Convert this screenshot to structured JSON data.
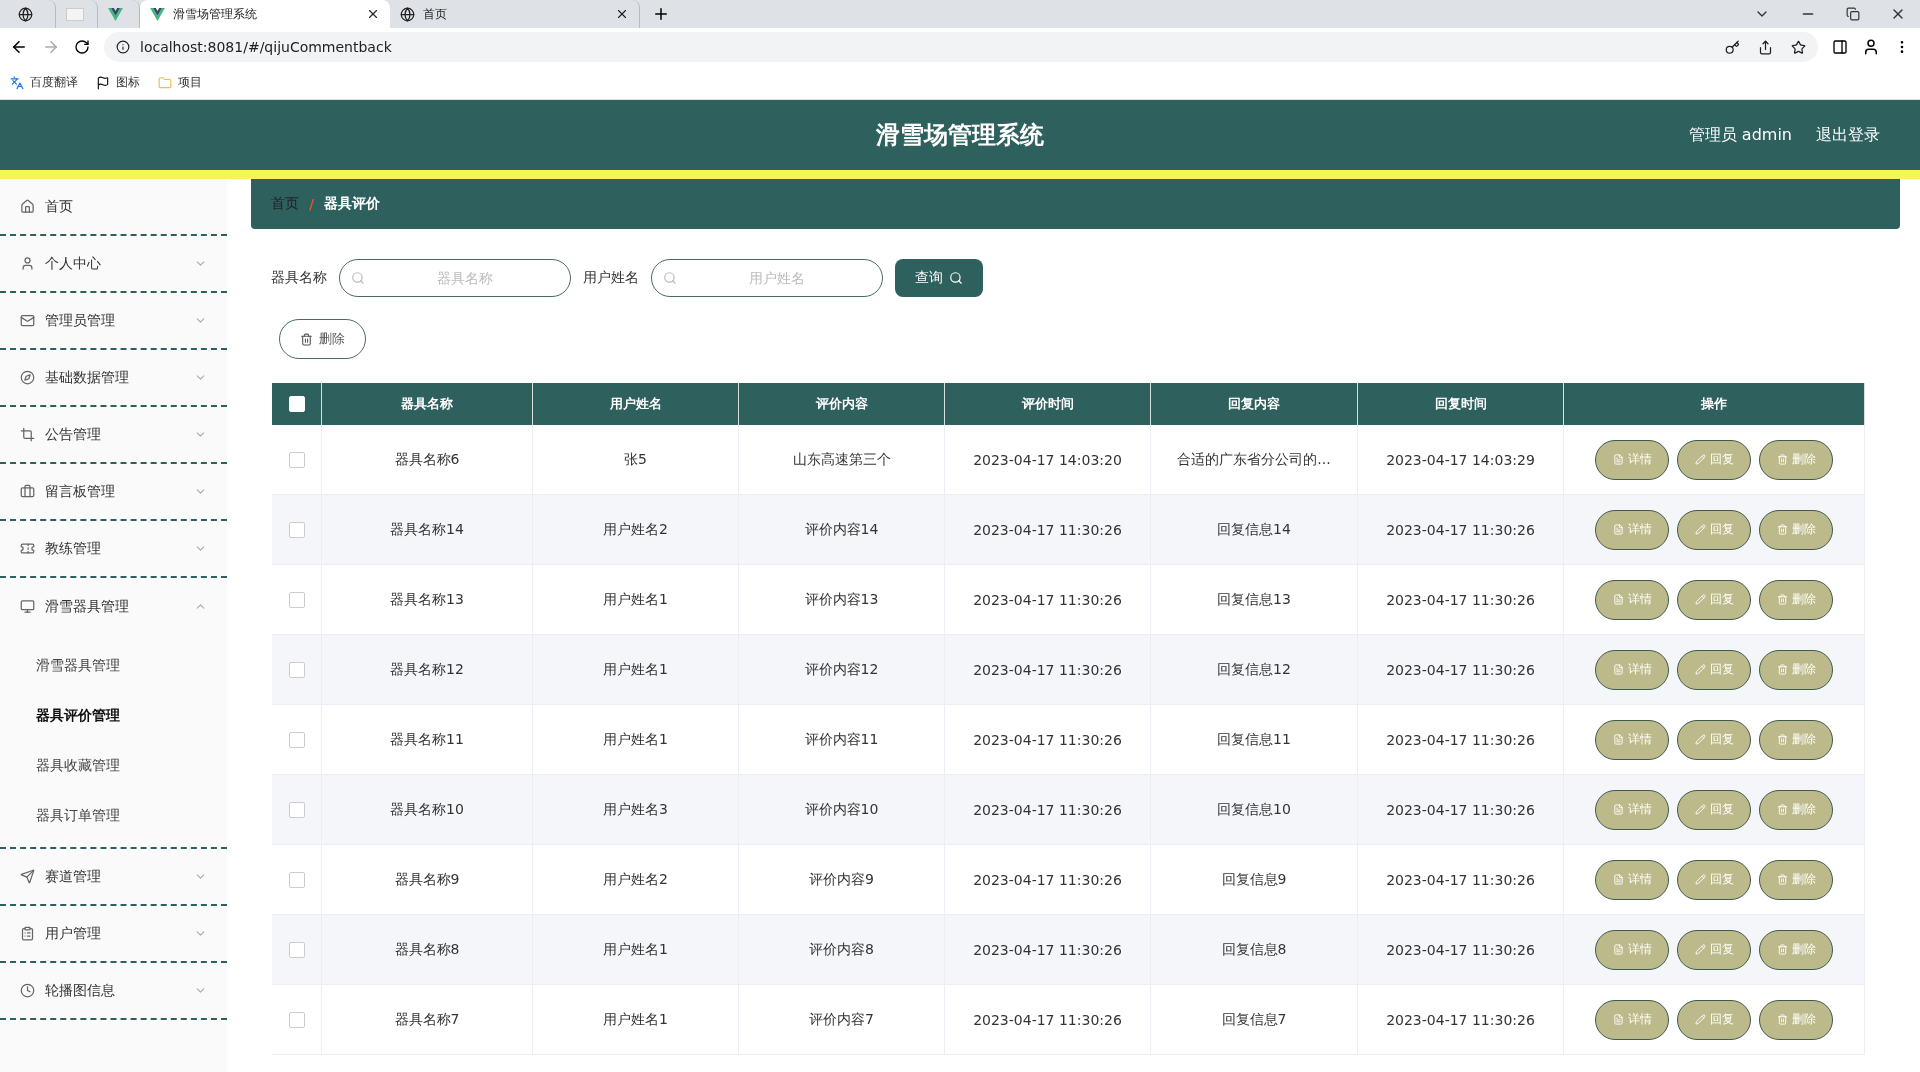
{
  "browser": {
    "tabs": [
      {
        "kind": "globe",
        "selected": false
      },
      {
        "kind": "blank",
        "selected": false
      },
      {
        "kind": "vue",
        "selected": false
      },
      {
        "kind": "vue",
        "label": "滑雪场管理系统",
        "selected": true
      },
      {
        "kind": "globe",
        "label": "首页",
        "selected": false
      }
    ],
    "address": "localhost:8081/#/qijuCommentback",
    "bookmarks": [
      {
        "kind": "translate",
        "label": "百度翻译"
      },
      {
        "kind": "flag",
        "label": "图标"
      },
      {
        "kind": "folder",
        "label": "项目"
      }
    ]
  },
  "header": {
    "title": "滑雪场管理系统",
    "user": "管理员 admin",
    "logout": "退出登录"
  },
  "sidebar": {
    "items": [
      {
        "label": "首页"
      },
      {
        "label": "个人中心",
        "expanded": false
      },
      {
        "label": "管理员管理",
        "expanded": false
      },
      {
        "label": "基础数据管理",
        "expanded": false
      },
      {
        "label": "公告管理",
        "expanded": false
      },
      {
        "label": "留言板管理",
        "expanded": false
      },
      {
        "label": "教练管理",
        "expanded": false
      },
      {
        "label": "滑雪器具管理",
        "expanded": true,
        "children": [
          {
            "label": "滑雪器具管理",
            "selected": false
          },
          {
            "label": "器具评价管理",
            "selected": true
          },
          {
            "label": "器具收藏管理",
            "selected": false
          },
          {
            "label": "器具订单管理",
            "selected": false
          }
        ]
      },
      {
        "label": "赛道管理",
        "expanded": false
      },
      {
        "label": "用户管理",
        "expanded": false
      },
      {
        "label": "轮播图信息",
        "expanded": false
      }
    ]
  },
  "breadcrumb": {
    "items": [
      "首页",
      "器具评价"
    ],
    "separator": "/"
  },
  "search": {
    "fields": [
      {
        "label": "器具名称",
        "placeholder": "器具名称"
      },
      {
        "label": "用户姓名",
        "placeholder": "用户姓名"
      }
    ],
    "button": "查询"
  },
  "delete_button": "删除",
  "table": {
    "columns": [
      "器具名称",
      "用户姓名",
      "评价内容",
      "评价时间",
      "回复内容",
      "回复时间",
      "操作"
    ],
    "select_all_checked": false,
    "rows": [
      {
        "checked": false,
        "cells": [
          "器具名称6",
          "张5",
          "山东高速第三个",
          "2023-04-17 14:03:20",
          "合适的广东省分公司的...",
          "2023-04-17 14:03:29"
        ],
        "actions": [
          "详情",
          "回复",
          "删除"
        ]
      },
      {
        "checked": false,
        "cells": [
          "器具名称14",
          "用户姓名2",
          "评价内容14",
          "2023-04-17 11:30:26",
          "回复信息14",
          "2023-04-17 11:30:26"
        ],
        "actions": [
          "详情",
          "回复",
          "删除"
        ]
      },
      {
        "checked": false,
        "cells": [
          "器具名称13",
          "用户姓名1",
          "评价内容13",
          "2023-04-17 11:30:26",
          "回复信息13",
          "2023-04-17 11:30:26"
        ],
        "actions": [
          "详情",
          "回复",
          "删除"
        ]
      },
      {
        "checked": false,
        "cells": [
          "器具名称12",
          "用户姓名1",
          "评价内容12",
          "2023-04-17 11:30:26",
          "回复信息12",
          "2023-04-17 11:30:26"
        ],
        "actions": [
          "详情",
          "回复",
          "删除"
        ]
      },
      {
        "checked": false,
        "cells": [
          "器具名称11",
          "用户姓名1",
          "评价内容11",
          "2023-04-17 11:30:26",
          "回复信息11",
          "2023-04-17 11:30:26"
        ],
        "actions": [
          "详情",
          "回复",
          "删除"
        ]
      },
      {
        "checked": false,
        "cells": [
          "器具名称10",
          "用户姓名3",
          "评价内容10",
          "2023-04-17 11:30:26",
          "回复信息10",
          "2023-04-17 11:30:26"
        ],
        "actions": [
          "详情",
          "回复",
          "删除"
        ]
      },
      {
        "checked": false,
        "cells": [
          "器具名称9",
          "用户姓名2",
          "评价内容9",
          "2023-04-17 11:30:26",
          "回复信息9",
          "2023-04-17 11:30:26"
        ],
        "actions": [
          "详情",
          "回复",
          "删除"
        ]
      },
      {
        "checked": false,
        "cells": [
          "器具名称8",
          "用户姓名1",
          "评价内容8",
          "2023-04-17 11:30:26",
          "回复信息8",
          "2023-04-17 11:30:26"
        ],
        "actions": [
          "详情",
          "回复",
          "删除"
        ]
      },
      {
        "checked": false,
        "cells": [
          "器具名称7",
          "用户姓名1",
          "评价内容7",
          "2023-04-17 11:30:26",
          "回复信息7",
          "2023-04-17 11:30:26"
        ],
        "actions": [
          "详情",
          "回复",
          "删除"
        ]
      }
    ]
  }
}
